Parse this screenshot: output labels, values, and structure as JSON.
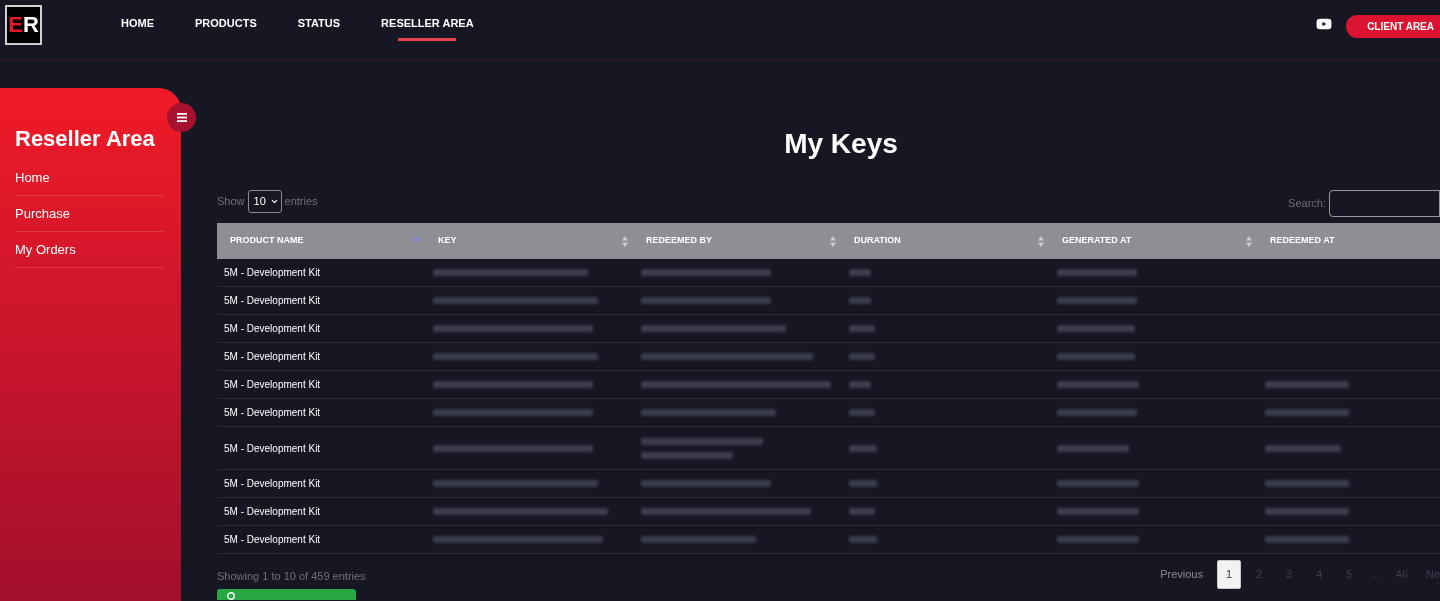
{
  "logo": {
    "letters": [
      {
        "text": "E",
        "color": "#e3192b"
      },
      {
        "text": "R",
        "color": "#ffffff"
      }
    ]
  },
  "nav": {
    "items": [
      {
        "label": "HOME",
        "selected": false
      },
      {
        "label": "PRODUCTS",
        "selected": false
      },
      {
        "label": "STATUS",
        "selected": false
      },
      {
        "label": "RESELLER AREA",
        "selected": true
      }
    ],
    "client_area_button": "CLIENT AREA"
  },
  "sidebar": {
    "title": "Reseller Area",
    "items": [
      {
        "label": "Home"
      },
      {
        "label": "Purchase"
      },
      {
        "label": "My Orders"
      }
    ]
  },
  "page_title": "My Keys",
  "length_menu": {
    "label_before": "Show",
    "value": "10",
    "label_after": "entries"
  },
  "search": {
    "label": "Search:"
  },
  "table": {
    "columns": [
      {
        "label": "PRODUCT NAME",
        "kind": "ascending"
      },
      {
        "label": "KEY",
        "kind": "sortable"
      },
      {
        "label": "REDEEMED BY",
        "kind": "sortable"
      },
      {
        "label": "DURATION",
        "kind": "sortable"
      },
      {
        "label": "GENERATED AT",
        "kind": "sortable"
      },
      {
        "label": "REDEEMED AT",
        "kind": "plain"
      }
    ],
    "rows": [
      {
        "product_name": "5M - Development Kit",
        "key_redacted": true,
        "redeemed_by_redacted": true,
        "redeemed_by_wrapped": false,
        "duration_redacted": true,
        "generated_at_redacted": true,
        "redeemed_at_redacted": false
      },
      {
        "product_name": "5M - Development Kit",
        "key_redacted": true,
        "redeemed_by_redacted": true,
        "redeemed_by_wrapped": false,
        "duration_redacted": true,
        "generated_at_redacted": true,
        "redeemed_at_redacted": false
      },
      {
        "product_name": "5M - Development Kit",
        "key_redacted": true,
        "redeemed_by_redacted": true,
        "redeemed_by_wrapped": false,
        "duration_redacted": true,
        "generated_at_redacted": true,
        "redeemed_at_redacted": false
      },
      {
        "product_name": "5M - Development Kit",
        "key_redacted": true,
        "redeemed_by_redacted": true,
        "redeemed_by_wrapped": false,
        "duration_redacted": true,
        "generated_at_redacted": true,
        "redeemed_at_redacted": false
      },
      {
        "product_name": "5M - Development Kit",
        "key_redacted": true,
        "redeemed_by_redacted": true,
        "redeemed_by_wrapped": false,
        "duration_redacted": true,
        "generated_at_redacted": true,
        "redeemed_at_redacted": true
      },
      {
        "product_name": "5M - Development Kit",
        "key_redacted": true,
        "redeemed_by_redacted": true,
        "redeemed_by_wrapped": false,
        "duration_redacted": true,
        "generated_at_redacted": true,
        "redeemed_at_redacted": true
      },
      {
        "product_name": "5M - Development Kit",
        "key_redacted": true,
        "redeemed_by_redacted": true,
        "redeemed_by_wrapped": true,
        "duration_redacted": true,
        "generated_at_redacted": true,
        "redeemed_at_redacted": true
      },
      {
        "product_name": "5M - Development Kit",
        "key_redacted": true,
        "redeemed_by_redacted": true,
        "redeemed_by_wrapped": false,
        "duration_redacted": true,
        "generated_at_redacted": true,
        "redeemed_at_redacted": true
      },
      {
        "product_name": "5M - Development Kit",
        "key_redacted": true,
        "redeemed_by_redacted": true,
        "redeemed_by_wrapped": false,
        "duration_redacted": true,
        "generated_at_redacted": true,
        "redeemed_at_redacted": true
      },
      {
        "product_name": "5M - Development Kit",
        "key_redacted": true,
        "redeemed_by_redacted": true,
        "redeemed_by_wrapped": false,
        "duration_redacted": true,
        "generated_at_redacted": true,
        "redeemed_at_redacted": true
      }
    ]
  },
  "info": "Showing 1 to 10 of 459 entries",
  "pagination": [
    {
      "label": "Previous",
      "kind": "previous",
      "selected": false
    },
    {
      "label": "1",
      "kind": "page",
      "selected": true
    },
    {
      "label": "2",
      "kind": "page",
      "selected": false
    },
    {
      "label": "3",
      "kind": "page",
      "selected": false
    },
    {
      "label": "4",
      "kind": "page",
      "selected": false
    },
    {
      "label": "5",
      "kind": "page",
      "selected": false
    },
    {
      "label": "…",
      "kind": "ellipsis",
      "selected": false
    },
    {
      "label": "46",
      "kind": "page",
      "selected": false
    },
    {
      "label": "Ne",
      "kind": "next",
      "selected": false
    }
  ]
}
